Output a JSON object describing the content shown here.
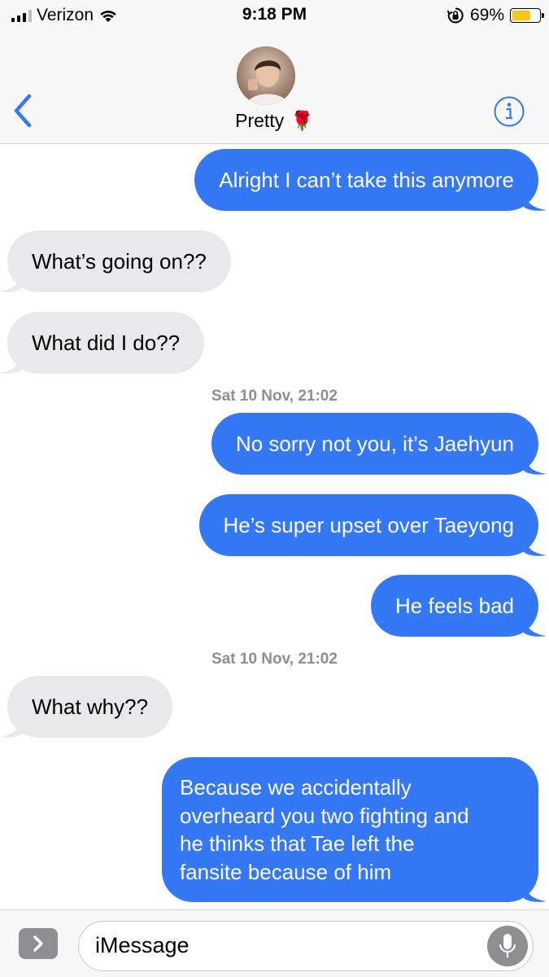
{
  "status_bar": {
    "carrier": "Verizon",
    "time": "9:18 PM",
    "battery_percent": "69%",
    "battery_level": 0.69,
    "icons": [
      "signal-icon",
      "wifi-icon",
      "orientation-lock-icon",
      "battery-icon"
    ]
  },
  "header": {
    "contact_name": "Pretty",
    "contact_emoji": "🌹",
    "icons": [
      "back-chevron-icon",
      "info-icon"
    ]
  },
  "messages": [
    {
      "direction": "sent",
      "text": "Alright I can’t take this anymore"
    },
    {
      "direction": "received",
      "text": "What’s going on??"
    },
    {
      "direction": "received",
      "text": "What did I do??"
    },
    {
      "direction": "sent",
      "text": "No sorry not you, it’s Jaehyun"
    },
    {
      "direction": "sent",
      "text": "He’s super upset over Taeyong"
    },
    {
      "direction": "sent",
      "text": "He feels bad"
    },
    {
      "direction": "received",
      "text": "What why??"
    },
    {
      "direction": "sent",
      "lines": [
        "Because we accidentally",
        "overheard you two fighting and",
        "he thinks that Tae left the",
        "fansite because of him"
      ]
    }
  ],
  "timestamps": [
    {
      "day": "Sat 10 Nov,",
      "time": "21:02"
    },
    {
      "day": "Sat 10 Nov,",
      "time": "21:02"
    }
  ],
  "compose": {
    "placeholder": "iMessage",
    "icons": [
      "app-drawer-chevron-icon",
      "microphone-icon"
    ]
  },
  "colors": {
    "sent_bubble": "#3478f6",
    "received_bubble": "#e9e9eb",
    "timestamp_text": "#8e8e93",
    "accent": "#3478f6",
    "battery_fill": "#f5c517"
  }
}
